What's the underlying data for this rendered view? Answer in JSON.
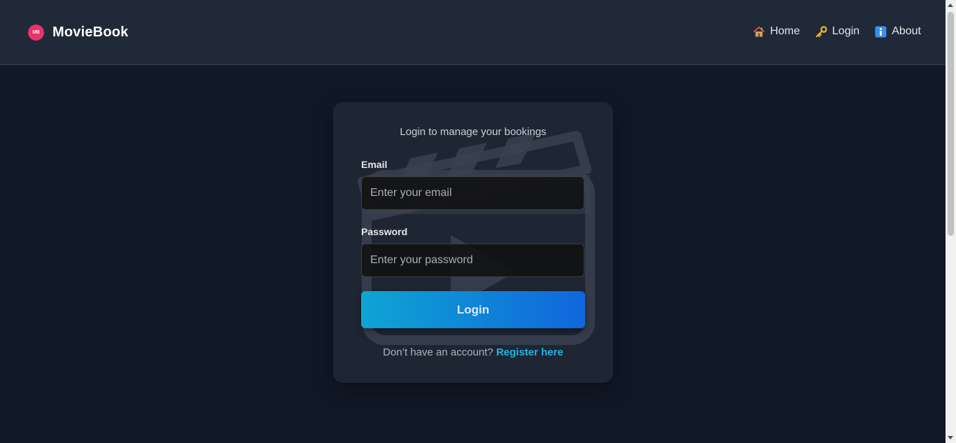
{
  "navbar": {
    "logo_text": "MB",
    "brand_name": "MovieBook",
    "links": [
      {
        "label": "Home",
        "icon": "house-icon"
      },
      {
        "label": "Login",
        "icon": "key-icon"
      },
      {
        "label": "About",
        "icon": "info-icon"
      }
    ]
  },
  "login_card": {
    "subtitle": "Login to manage your bookings",
    "email_label": "Email",
    "email_placeholder": "Enter your email",
    "email_value": "",
    "password_label": "Password",
    "password_placeholder": "Enter your password",
    "password_value": "",
    "submit_label": "Login",
    "register_prompt": "Don’t have an account?",
    "register_link": "Register here",
    "watermark_icon": "clapperboard-play-icon"
  },
  "colors": {
    "page_bg": "#111827",
    "navbar_bg": "#1f2937",
    "card_bg": "#1e2533",
    "accent_start": "#0ea5d3",
    "accent_end": "#1066dc",
    "link": "#22b4e6",
    "logo": "#e8336b"
  }
}
